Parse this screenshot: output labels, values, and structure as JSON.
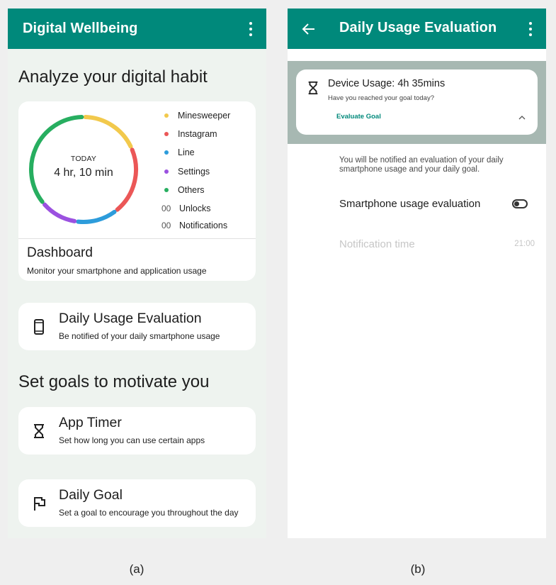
{
  "left_panel": {
    "app_title": "Digital Wellbeing",
    "section_analyze": "Analyze your digital habit",
    "dashboard": {
      "today_label": "TODAY",
      "today_value": "4 hr, 10 min",
      "legend": [
        {
          "label": "Minesweeper",
          "color": "#f2c94c"
        },
        {
          "label": "Instagram",
          "color": "#eb5757"
        },
        {
          "label": "Line",
          "color": "#2d9cdb"
        },
        {
          "label": "Settings",
          "color": "#9b51e0"
        },
        {
          "label": "Others",
          "color": "#27ae60"
        }
      ],
      "unlocks_count": "00",
      "unlocks_label": "Unlocks",
      "notifications_count": "00",
      "notifications_label": "Notifications",
      "title": "Dashboard",
      "subtitle": "Monitor your smartphone and application usage"
    },
    "daily_usage": {
      "title": "Daily Usage Evaluation",
      "subtitle": "Be notified of your daily smartphone usage",
      "icon": "phone-icon"
    },
    "section_goals": "Set goals to motivate you",
    "app_timer": {
      "title": "App Timer",
      "subtitle": "Set how long you can use certain apps",
      "icon": "hourglass-icon"
    },
    "daily_goal": {
      "title": "Daily Goal",
      "subtitle": "Set a goal to encourage you throughout the day",
      "icon": "flag-icon"
    },
    "caption": "(a)"
  },
  "right_panel": {
    "app_title": "Daily Usage Evaluation",
    "goal_card": {
      "title": "Device Usage: 4h 35mins",
      "subtitle": "Have you reached your goal today?",
      "link": "Evaluate Goal",
      "icon": "hourglass-icon"
    },
    "notify_text": "You will be notified an evaluation of your daily smartphone usage and your daily goal.",
    "setting_label": "Smartphone usage evaluation",
    "toggle_on": false,
    "notification_time_label": "Notification time",
    "notification_time_value": "21:00",
    "caption": "(b)"
  },
  "colors": {
    "app_bar": "#00897b",
    "background_left": "#eef3ef",
    "accent_link": "#00897b"
  }
}
